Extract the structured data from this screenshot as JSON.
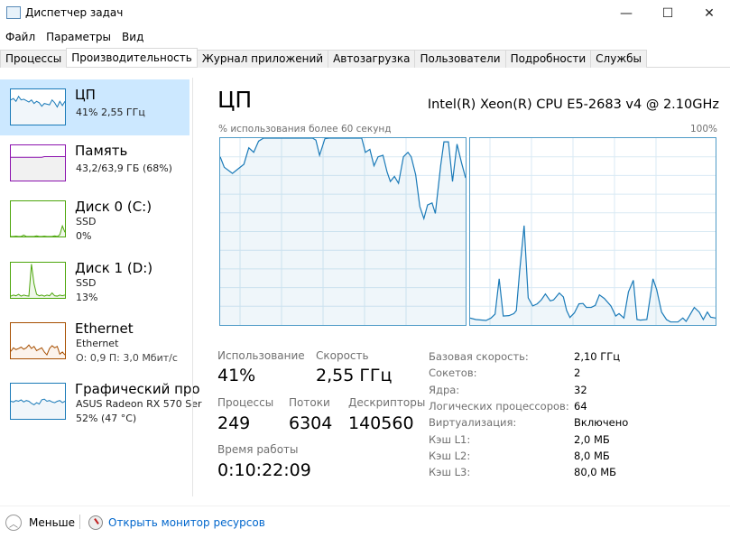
{
  "window": {
    "title": "Диспетчер задач",
    "minimize_icon": "minimize-icon",
    "maximize_icon": "maximize-icon",
    "close_icon": "close-icon"
  },
  "menu": [
    "Файл",
    "Параметры",
    "Вид"
  ],
  "tabs": [
    {
      "label": "Процессы",
      "active": false
    },
    {
      "label": "Производительность",
      "active": true
    },
    {
      "label": "Журнал приложений",
      "active": false
    },
    {
      "label": "Автозагрузка",
      "active": false
    },
    {
      "label": "Пользователи",
      "active": false
    },
    {
      "label": "Подробности",
      "active": false
    },
    {
      "label": "Службы",
      "active": false
    }
  ],
  "sidebar": {
    "items": [
      {
        "name": "ЦП",
        "line1": "41% 2,55 ГГц",
        "line2": "",
        "color": "#1a7ab8",
        "fill": "#f1f6fa",
        "values": [
          70,
          74,
          66,
          80,
          70,
          72,
          68,
          64,
          70,
          60,
          66,
          62,
          52,
          60,
          58,
          56,
          70,
          62,
          50,
          66,
          54,
          66
        ]
      },
      {
        "name": "Память",
        "line1": "43,2/63,9 ГБ (68%)",
        "line2": "",
        "color": "#8b12ae",
        "fill": "#f1f1f1",
        "values": [
          66,
          66,
          66,
          66,
          66,
          66,
          66,
          66,
          66,
          66,
          66,
          66,
          66,
          68,
          68,
          68,
          68,
          68,
          68,
          68,
          68,
          68
        ]
      },
      {
        "name": "Диск 0 (C:)",
        "line1": "SSD",
        "line2": "0%",
        "color": "#4da60c",
        "fill": "#eff7e9",
        "values": [
          0,
          0,
          1,
          0,
          0,
          4,
          0,
          0,
          0,
          0,
          2,
          0,
          0,
          1,
          0,
          0,
          0,
          2,
          0,
          5,
          30,
          12
        ]
      },
      {
        "name": "Диск 1 (D:)",
        "line1": "SSD",
        "line2": "13%",
        "color": "#4da60c",
        "fill": "#eff7e9",
        "values": [
          5,
          8,
          6,
          10,
          5,
          8,
          6,
          5,
          96,
          40,
          10,
          6,
          8,
          5,
          8,
          6,
          14,
          6,
          5,
          8,
          6,
          8
        ]
      },
      {
        "name": "Ethernet",
        "line1": "Ethernet",
        "line2": "О: 0,9 П: 3,0 Мбит/с",
        "color": "#a74f01",
        "fill": "#fcf3eb",
        "values": [
          20,
          30,
          25,
          28,
          32,
          26,
          30,
          38,
          28,
          34,
          22,
          26,
          30,
          18,
          10,
          28,
          36,
          30,
          34,
          12,
          18,
          10
        ]
      },
      {
        "name": "Графический про",
        "line1": "ASUS Radeon RX 570 Ser",
        "line2": "52% (47 °C)",
        "color": "#1a7ab8",
        "fill": "#f1f6fa",
        "values": [
          50,
          48,
          52,
          50,
          54,
          48,
          52,
          50,
          44,
          40,
          46,
          42,
          54,
          56,
          50,
          52,
          48,
          46,
          50,
          52,
          46,
          50
        ]
      }
    ]
  },
  "cpu": {
    "title": "ЦП",
    "model": "Intel(R) Xeon(R) CPU E5-2683 v4 @ 2.10GHz",
    "graph_caption": "% использования более 60 секунд",
    "graph_max": "100%",
    "graph_color": "#1a7ab8",
    "graphs": [
      {
        "points": [
          [
            0,
            90
          ],
          [
            1,
            84.4
          ],
          [
            3,
            81.1
          ],
          [
            4.2,
            83.2
          ],
          [
            5.8,
            86
          ],
          [
            7,
            94.8
          ],
          [
            8.2,
            92.4
          ],
          [
            9.4,
            98.4
          ],
          [
            10.6,
            100
          ],
          [
            22.6,
            100
          ],
          [
            23.4,
            98.9
          ],
          [
            24.3,
            90.8
          ],
          [
            25.6,
            99.7
          ],
          [
            26.6,
            100
          ],
          [
            34.6,
            100
          ],
          [
            35.5,
            92.4
          ],
          [
            36.6,
            94
          ],
          [
            37.6,
            85.2
          ],
          [
            38.6,
            90
          ],
          [
            39.8,
            90.8
          ],
          [
            40.8,
            81.9
          ],
          [
            41.6,
            76.8
          ],
          [
            42.6,
            79.5
          ],
          [
            43.6,
            75.8
          ],
          [
            44.8,
            90
          ],
          [
            45.9,
            92.4
          ],
          [
            46.7,
            90
          ],
          [
            47.8,
            80.3
          ],
          [
            48.8,
            63.4
          ],
          [
            49.8,
            56.9
          ],
          [
            50.7,
            64.2
          ],
          [
            51.8,
            65.3
          ],
          [
            52.6,
            59.7
          ],
          [
            53.9,
            85.2
          ],
          [
            54.7,
            98
          ],
          [
            55.8,
            98
          ],
          [
            56.8,
            76.8
          ],
          [
            57.9,
            96.8
          ],
          [
            59,
            86.8
          ],
          [
            60,
            78.7
          ]
        ]
      },
      {
        "points": [
          [
            0,
            3.7
          ],
          [
            1.4,
            2.9
          ],
          [
            3.9,
            2.4
          ],
          [
            5.1,
            3.7
          ],
          [
            6.1,
            5.8
          ],
          [
            7.1,
            24.7
          ],
          [
            8.1,
            4.8
          ],
          [
            9.5,
            5
          ],
          [
            10.7,
            6.1
          ],
          [
            11.3,
            7.7
          ],
          [
            12.1,
            28.7
          ],
          [
            13.2,
            53.2
          ],
          [
            14.2,
            14.5
          ],
          [
            15.3,
            10.2
          ],
          [
            16.4,
            11.3
          ],
          [
            17.4,
            13.4
          ],
          [
            18.4,
            16.6
          ],
          [
            19.6,
            12.9
          ],
          [
            20.4,
            13.4
          ],
          [
            21.8,
            17.1
          ],
          [
            22.8,
            15
          ],
          [
            23.6,
            7.7
          ],
          [
            24.4,
            4
          ],
          [
            25.5,
            6.5
          ],
          [
            26.6,
            11.3
          ],
          [
            27.6,
            11.5
          ],
          [
            28.4,
            9.4
          ],
          [
            29.6,
            9.4
          ],
          [
            30.6,
            10.5
          ],
          [
            31.6,
            16.1
          ],
          [
            32.8,
            14.2
          ],
          [
            34.4,
            10.2
          ],
          [
            35.6,
            4.8
          ],
          [
            36.4,
            6.1
          ],
          [
            37.6,
            3.7
          ],
          [
            38.7,
            17.7
          ],
          [
            39.9,
            23.9
          ],
          [
            40.8,
            2.9
          ],
          [
            41.6,
            2.6
          ],
          [
            43.2,
            2.9
          ],
          [
            44.7,
            24.7
          ],
          [
            45.6,
            19
          ],
          [
            46.8,
            6.9
          ],
          [
            48,
            2.9
          ],
          [
            49,
            1.6
          ],
          [
            50.8,
            1.6
          ],
          [
            52,
            3.7
          ],
          [
            52.8,
            1.9
          ],
          [
            54.8,
            9.4
          ],
          [
            56,
            6.9
          ],
          [
            57,
            2.9
          ],
          [
            58,
            6.9
          ],
          [
            58.8,
            4.2
          ],
          [
            60,
            3.7
          ]
        ]
      }
    ],
    "stats": {
      "usage_label": "Использование",
      "usage": "41%",
      "speed_label": "Скорость",
      "speed": "2,55 ГГц",
      "processes_label": "Процессы",
      "processes": "249",
      "threads_label": "Потоки",
      "threads": "6304",
      "handles_label": "Дескрипторы",
      "handles": "140560",
      "uptime_label": "Время работы",
      "uptime": "0:10:22:09"
    },
    "details": [
      {
        "k": "Базовая скорость:",
        "v": "2,10 ГГц"
      },
      {
        "k": "Сокетов:",
        "v": "2"
      },
      {
        "k": "Ядра:",
        "v": "32"
      },
      {
        "k": "Логических процессоров:",
        "v": "64"
      },
      {
        "k": "Виртуализация:",
        "v": "Включено"
      },
      {
        "k": "Кэш L1:",
        "v": "2,0 МБ"
      },
      {
        "k": "Кэш L2:",
        "v": "8,0 МБ"
      },
      {
        "k": "Кэш L3:",
        "v": "80,0 МБ"
      }
    ]
  },
  "footer": {
    "less_label": "Меньше",
    "monitor_link": "Открыть монитор ресурсов"
  }
}
